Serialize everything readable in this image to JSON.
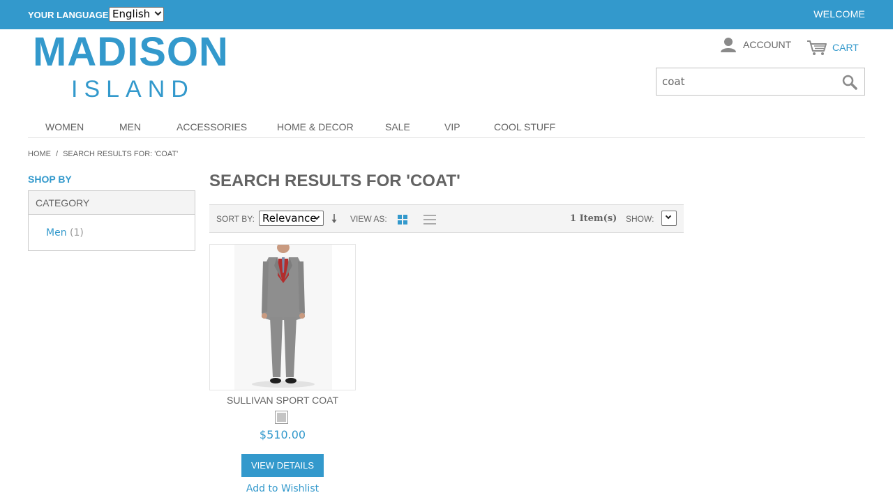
{
  "header": {
    "language_label": "YOUR LANGUAGE:",
    "language_selected": "English",
    "welcome": "WELCOME",
    "logo_top": "MADISON",
    "logo_bottom": "ISLAND",
    "account_label": "ACCOUNT",
    "cart_label": "CART",
    "search_value": "coat",
    "brand_color": "#3399cc"
  },
  "nav": {
    "items": [
      "WOMEN",
      "MEN",
      "ACCESSORIES",
      "HOME & DECOR",
      "SALE",
      "VIP",
      "COOL STUFF"
    ]
  },
  "breadcrumb": {
    "home": "HOME",
    "separator": "/",
    "current": "SEARCH RESULTS FOR: 'COAT'"
  },
  "sidebar": {
    "title": "SHOP BY",
    "section": "CATEGORY",
    "items": [
      {
        "label": "Men",
        "count": "(1)"
      }
    ]
  },
  "main": {
    "title": "SEARCH RESULTS FOR 'COAT'",
    "toolbar": {
      "sort_label": "SORT BY:",
      "sort_selected": "Relevance",
      "view_label": "VIEW AS:",
      "view_mode": "grid",
      "item_count": "1 Item(s)",
      "show_label": "SHOW:"
    },
    "products": [
      {
        "name": "SULLIVAN SPORT COAT",
        "price": "$510.00",
        "swatch_color": "#c4c4c4",
        "button": "VIEW DETAILS",
        "wishlist": "Add to Wishlist"
      }
    ]
  },
  "icons": {
    "account": "user-icon",
    "cart": "cart-icon",
    "search": "search-icon",
    "sort_direction": "arrow-down-icon",
    "grid": "grid-icon",
    "list": "list-icon"
  }
}
